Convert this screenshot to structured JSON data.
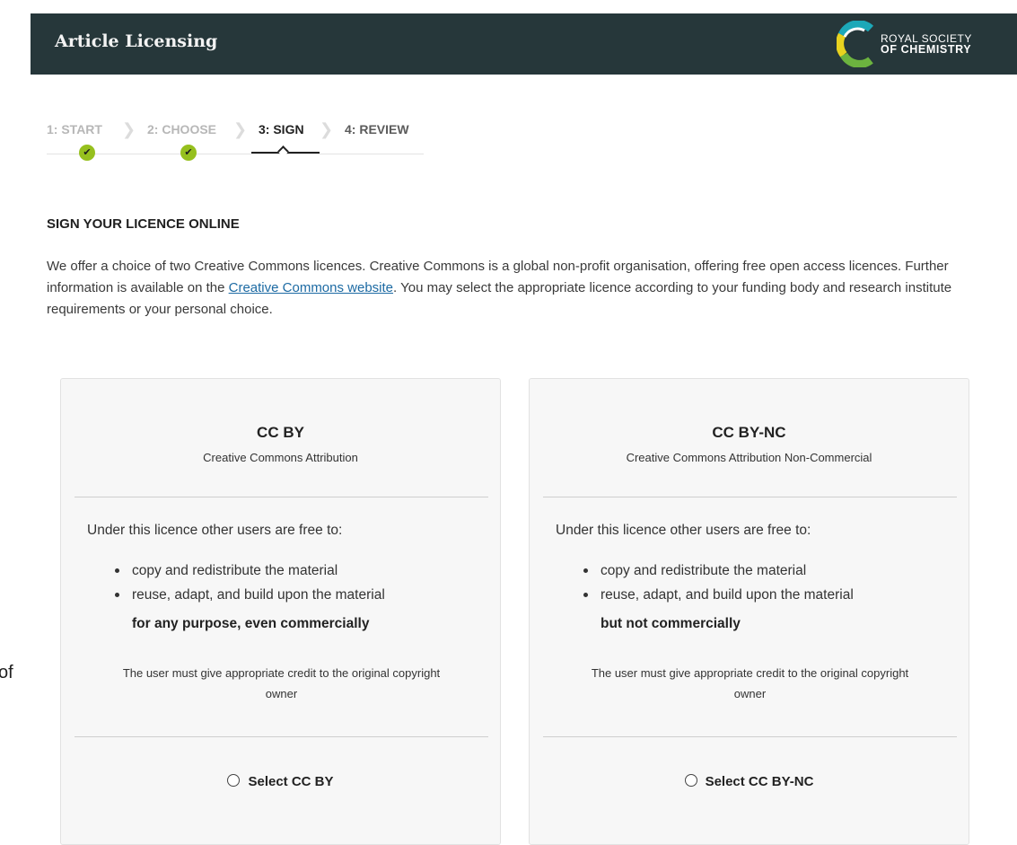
{
  "header": {
    "title": "Article Licensing",
    "logo_line1": "ROYAL SOCIETY",
    "logo_line2": "OF CHEMISTRY"
  },
  "stepper": {
    "steps": [
      {
        "label": "1: START",
        "state": "done"
      },
      {
        "label": "2: CHOOSE",
        "state": "done"
      },
      {
        "label": "3: SIGN",
        "state": "active"
      },
      {
        "label": "4: REVIEW",
        "state": "todo"
      }
    ],
    "check_glyph": "✔"
  },
  "section": {
    "title": "SIGN YOUR LICENCE ONLINE",
    "intro_before": "We offer a choice of two Creative Commons licences. Creative Commons is a global non-profit organisation, offering free open access licences. Further information is available on the ",
    "intro_link": "Creative Commons website",
    "intro_after": ". You may select the appropriate licence according to your funding body and research institute requirements or your personal choice."
  },
  "stray_text": "of",
  "licences": [
    {
      "title": "CC BY",
      "subtitle": "Creative Commons Attribution",
      "lead": "Under this licence other users are free to:",
      "bullets": [
        "copy and redistribute the material",
        "reuse, adapt, and build upon the material"
      ],
      "emphasis": "for any purpose, even commercially",
      "credit": "The user must give appropriate credit to the original copyright owner",
      "select_label": "Select CC BY"
    },
    {
      "title": "CC BY-NC",
      "subtitle": "Creative Commons Attribution Non-Commercial",
      "lead": "Under this licence other users are free to:",
      "bullets": [
        "copy and redistribute the material",
        "reuse, adapt, and build upon the material"
      ],
      "emphasis": "but not commercially",
      "credit": "The user must give appropriate credit to the original copyright owner",
      "select_label": "Select CC BY-NC"
    }
  ],
  "colors": {
    "header_bg": "#26373a",
    "check_green": "#96c01e",
    "link": "#1c6aa3",
    "card_bg": "#f7f7f7",
    "logo_arc_teal": "#1ca8b8",
    "logo_arc_yellow": "#e8d21f",
    "logo_arc_green": "#6cb33f"
  }
}
